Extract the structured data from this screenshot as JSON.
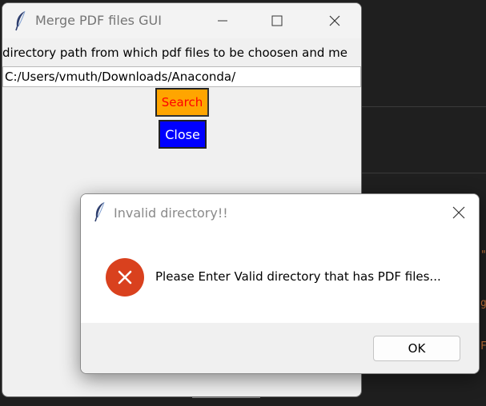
{
  "main_window": {
    "title": "Merge PDF files GUI",
    "title_icon": "feather-icon",
    "controls": {
      "minimize_icon": "minimize-icon",
      "maximize_icon": "maximize-icon",
      "close_icon": "close-icon"
    },
    "prompt_label": "directory path from which pdf files to be choosen and me",
    "path_value": "C:/Users/vmuth/Downloads/Anaconda/",
    "search_button": {
      "label": "Search",
      "bg": "#ffa500",
      "fg": "#ff0000"
    },
    "close_button": {
      "label": "Close",
      "bg": "#0000ff",
      "fg": "#ffffff"
    }
  },
  "dialog": {
    "title": "Invalid directory!!",
    "title_icon": "feather-icon",
    "close_icon": "close-icon",
    "icon": "error-icon",
    "icon_color": "#d9411e",
    "message": "Please Enter Valid directory that has PDF files...",
    "ok_label": "OK"
  }
}
